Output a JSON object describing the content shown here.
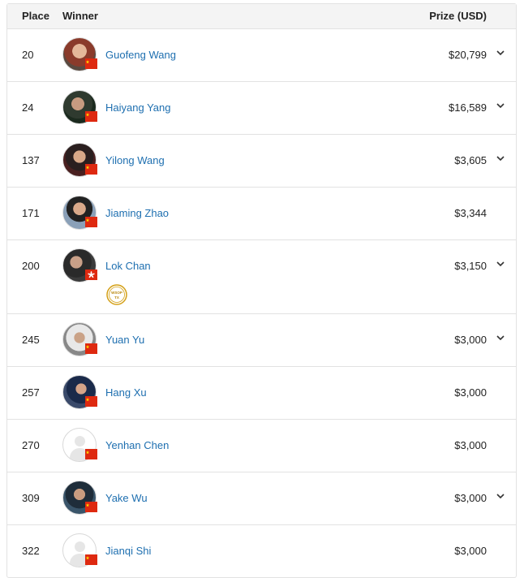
{
  "header": {
    "place": "Place",
    "winner": "Winner",
    "prize": "Prize (USD)"
  },
  "rows": [
    {
      "place": "20",
      "name": "Guofeng Wang",
      "prize": "$20,799",
      "flag": "china-flag-icon",
      "expandable": true
    },
    {
      "place": "24",
      "name": "Haiyang Yang",
      "prize": "$16,589",
      "flag": "china-flag-icon",
      "expandable": true
    },
    {
      "place": "137",
      "name": "Yilong Wang",
      "prize": "$3,605",
      "flag": "china-flag-icon",
      "expandable": true
    },
    {
      "place": "171",
      "name": "Jiaming Zhao",
      "prize": "$3,344",
      "flag": "china-flag-icon",
      "expandable": false
    },
    {
      "place": "200",
      "name": "Lok Chan",
      "prize": "$3,150",
      "flag": "hong-kong-flag-icon",
      "expandable": true,
      "badge": "wsop-bracelet-icon",
      "badge_text": [
        "WSOP",
        "TX"
      ]
    },
    {
      "place": "245",
      "name": "Yuan Yu",
      "prize": "$3,000",
      "flag": "china-flag-icon",
      "expandable": true
    },
    {
      "place": "257",
      "name": "Hang Xu",
      "prize": "$3,000",
      "flag": "china-flag-icon",
      "expandable": false
    },
    {
      "place": "270",
      "name": "Yenhan Chen",
      "prize": "$3,000",
      "flag": "china-flag-icon",
      "expandable": false,
      "no_photo": true
    },
    {
      "place": "309",
      "name": "Yake Wu",
      "prize": "$3,000",
      "flag": "china-flag-icon",
      "expandable": true
    },
    {
      "place": "322",
      "name": "Jianqi Shi",
      "prize": "$3,000",
      "flag": "china-flag-icon",
      "expandable": false,
      "no_photo": true
    }
  ],
  "colors": {
    "link": "#1e6fb0",
    "china_red": "#de2910",
    "hk_red": "#de2910",
    "badge_gold": "#d4a017"
  }
}
